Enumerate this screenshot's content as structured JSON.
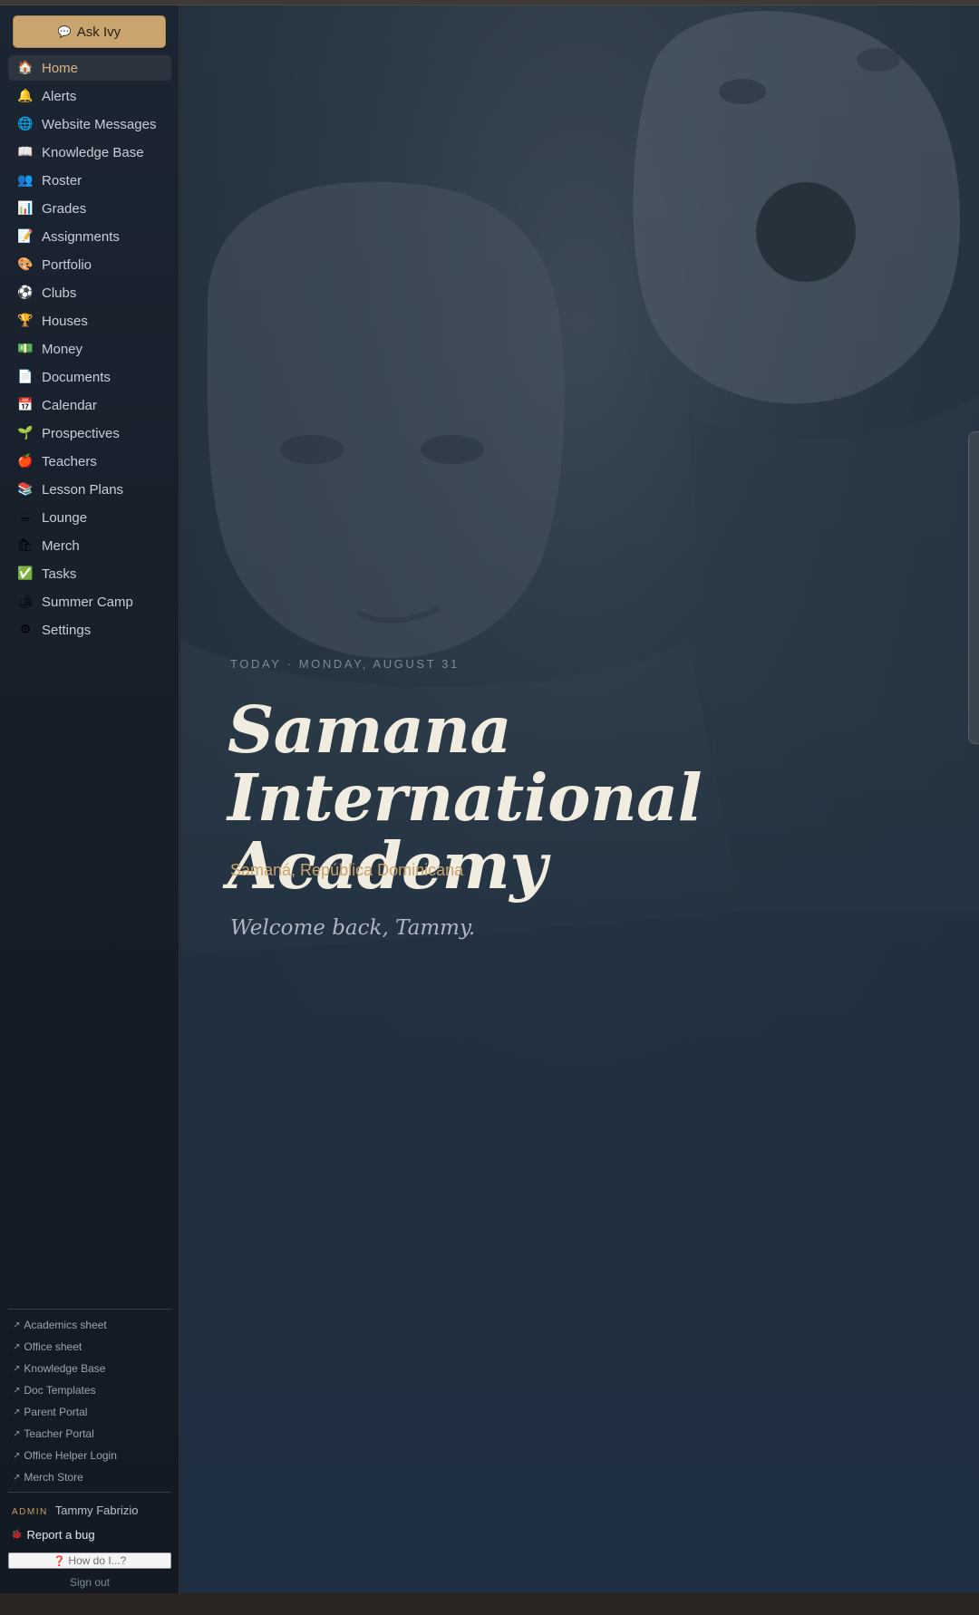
{
  "ask_ivy": {
    "icon": "chat-bubble-icon",
    "glyph": "💬",
    "label": "Ask Ivy"
  },
  "nav": [
    {
      "id": "home",
      "icon": "house-icon",
      "glyph": "🏠",
      "label": "Home",
      "active": true
    },
    {
      "id": "alerts",
      "icon": "bell-icon",
      "glyph": "🔔",
      "label": "Alerts"
    },
    {
      "id": "website-messages",
      "icon": "globe-icon",
      "glyph": "🌐",
      "label": "Website Messages"
    },
    {
      "id": "knowledge-base",
      "icon": "open-book-icon",
      "glyph": "📖",
      "label": "Knowledge Base"
    },
    {
      "id": "roster",
      "icon": "people-icon",
      "glyph": "👥",
      "label": "Roster"
    },
    {
      "id": "grades",
      "icon": "bar-chart-icon",
      "glyph": "📊",
      "label": "Grades"
    },
    {
      "id": "assignments",
      "icon": "memo-icon",
      "glyph": "📝",
      "label": "Assignments"
    },
    {
      "id": "portfolio",
      "icon": "palette-icon",
      "glyph": "🎨",
      "label": "Portfolio"
    },
    {
      "id": "clubs",
      "icon": "soccer-ball-icon",
      "glyph": "⚽",
      "label": "Clubs"
    },
    {
      "id": "houses",
      "icon": "trophy-icon",
      "glyph": "🏆",
      "label": "Houses"
    },
    {
      "id": "money",
      "icon": "banknote-icon",
      "glyph": "💵",
      "label": "Money"
    },
    {
      "id": "documents",
      "icon": "document-icon",
      "glyph": "📄",
      "label": "Documents"
    },
    {
      "id": "calendar",
      "icon": "calendar-icon",
      "glyph": "📅",
      "label": "Calendar"
    },
    {
      "id": "prospectives",
      "icon": "seedling-icon",
      "glyph": "🌱",
      "label": "Prospectives"
    },
    {
      "id": "teachers",
      "icon": "apple-icon",
      "glyph": "🍎",
      "label": "Teachers"
    },
    {
      "id": "lesson-plans",
      "icon": "books-icon",
      "glyph": "📚",
      "label": "Lesson Plans"
    },
    {
      "id": "lounge",
      "icon": "coffee-icon",
      "glyph": "☕",
      "label": "Lounge"
    },
    {
      "id": "merch",
      "icon": "shopping-bags-icon",
      "glyph": "🛍",
      "label": "Merch"
    },
    {
      "id": "tasks",
      "icon": "check-box-icon",
      "glyph": "✅",
      "label": "Tasks"
    },
    {
      "id": "summer-camp",
      "icon": "camping-icon",
      "glyph": "🏕",
      "label": "Summer Camp"
    },
    {
      "id": "settings",
      "icon": "gear-icon",
      "glyph": "⚙",
      "label": "Settings"
    }
  ],
  "external_links": [
    {
      "id": "academics-sheet",
      "label": "Academics sheet"
    },
    {
      "id": "office-sheet",
      "label": "Office sheet"
    },
    {
      "id": "knowledge-base",
      "label": "Knowledge Base"
    },
    {
      "id": "doc-templates",
      "label": "Doc Templates"
    },
    {
      "id": "parent-portal",
      "label": "Parent Portal"
    },
    {
      "id": "teacher-portal",
      "label": "Teacher Portal"
    },
    {
      "id": "office-helper-login",
      "label": "Office Helper Login"
    },
    {
      "id": "merch-store",
      "label": "Merch Store"
    }
  ],
  "external_arrow": "↗",
  "user": {
    "role": "ADMIN",
    "name": "Tammy Fabrizio"
  },
  "report_bug": {
    "icon": "bug-icon",
    "glyph": "🐞",
    "label": "Report a bug"
  },
  "help_input": {
    "icon": "question-mark-icon",
    "glyph": "❓",
    "placeholder": "How do I...?"
  },
  "sign_out": "Sign out",
  "hero": {
    "date_line": "TODAY · MONDAY, AUGUST 31",
    "school_name": "Samana International Academy",
    "location": "Samaná, República Dominicana",
    "welcome": "Welcome back, Tammy."
  },
  "colors": {
    "accent_gold": "#c9a46e",
    "active_nav_text": "#d9b47a",
    "sidebar_bg": "#151d28",
    "hero_bg": "#22303e",
    "title_cream": "#f1ece0"
  }
}
